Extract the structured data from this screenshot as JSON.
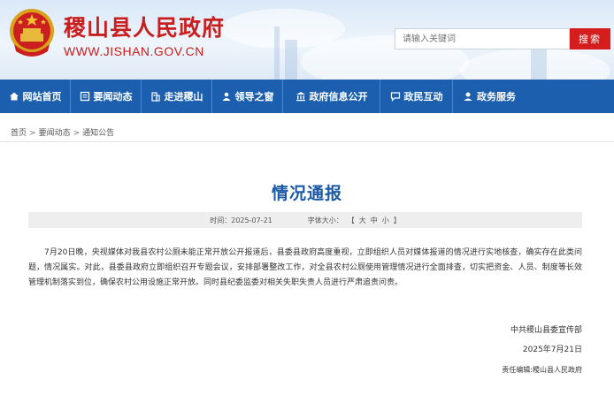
{
  "header": {
    "title": "稷山县人民政府",
    "domain": "WWW.JISHAN.GOV.CN",
    "search_placeholder": "请输入关键词",
    "search_button": "搜索"
  },
  "nav": {
    "items": [
      {
        "label": "网站首页",
        "icon": "home-icon"
      },
      {
        "label": "要闻动态",
        "icon": "news-icon"
      },
      {
        "label": "走进稷山",
        "icon": "building-icon"
      },
      {
        "label": "领导之窗",
        "icon": "leader-icon"
      },
      {
        "label": "政府信息公开",
        "icon": "institution-icon"
      },
      {
        "label": "政民互动",
        "icon": "chat-icon"
      },
      {
        "label": "政务服务",
        "icon": "service-icon"
      }
    ]
  },
  "breadcrumb": [
    "首页",
    "要闻动态",
    "通知公告"
  ],
  "article": {
    "title": "情况通报",
    "time_label": "时间：",
    "time": "2025-07-21",
    "font_size_label": "字体大小：",
    "font_open": "【",
    "font_large": "大",
    "font_medium": "中",
    "font_small": "小",
    "font_close": "】",
    "body": "7月20日晚，央视媒体对我县农村公厕未能正常开放公开报道后，县委县政府高度重视，立即组织人员对媒体报道的情况进行实地核查，确实存在此类问题，情况属实。对此，县委县政府立即组织召开专题会议，安排部署整改工作，对全县农村公厕使用管理情况进行全面排查，切实把资金、人员、制度等长效管理机制落实到位，确保农村公用设施正常开放。同时县纪委监委对相关失职失责人员进行严肃追责问责。",
    "signature": "中共稷山县委宣传部",
    "date": "2025年7月21日",
    "editor": "责任编辑:稷山县人民政府"
  },
  "colors": {
    "brand_red": "#c81e1e",
    "nav_blue": "#1b5fae",
    "title_blue": "#1c5aa6"
  }
}
